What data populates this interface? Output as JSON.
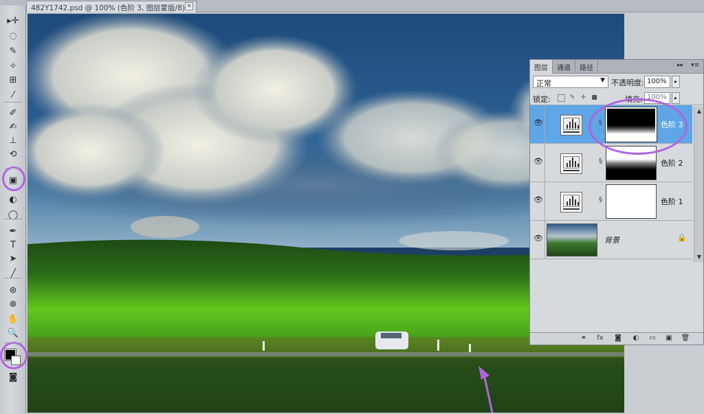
{
  "document": {
    "tab_title": "482Y1742.psd @ 100% (色阶 3, 图层蒙版/8) *",
    "close_glyph": "×"
  },
  "toolbox": {
    "tools": [
      {
        "name": "move-tool-icon",
        "glyph": "▸✛"
      },
      {
        "name": "lasso-tool-icon",
        "glyph": "◌"
      },
      {
        "name": "quick-select-icon",
        "glyph": "✎"
      },
      {
        "name": "magic-wand-icon",
        "glyph": "✧"
      },
      {
        "name": "crop-tool-icon",
        "glyph": "⊞"
      },
      {
        "name": "eyedropper-icon",
        "glyph": "⁄"
      },
      {
        "name": "healing-brush-icon",
        "glyph": "✐"
      },
      {
        "name": "brush-tool-icon",
        "glyph": "✍"
      },
      {
        "name": "clone-stamp-icon",
        "glyph": "⊥"
      },
      {
        "name": "history-brush-icon",
        "glyph": "⟲"
      },
      {
        "name": "gradient-tool-icon",
        "glyph": "▣"
      },
      {
        "name": "blur-tool-icon",
        "glyph": "◐"
      },
      {
        "name": "dodge-tool-icon",
        "glyph": "◯"
      },
      {
        "name": "pen-tool-icon",
        "glyph": "✒"
      },
      {
        "name": "type-tool-icon",
        "glyph": "T"
      },
      {
        "name": "path-select-icon",
        "glyph": "➤"
      },
      {
        "name": "line-tool-icon",
        "glyph": "╱"
      },
      {
        "name": "3d-rotate-icon",
        "glyph": "⊛"
      },
      {
        "name": "3d-orbit-icon",
        "glyph": "⊗"
      },
      {
        "name": "hand-tool-icon",
        "glyph": "✋"
      },
      {
        "name": "zoom-tool-icon",
        "glyph": "🔍"
      },
      {
        "name": "quick-mask-icon",
        "glyph": "◙"
      }
    ]
  },
  "layers_panel": {
    "tabs": [
      "图层",
      "通道",
      "路径"
    ],
    "menu_glyphs": [
      "▸▸",
      "▾≡"
    ],
    "blend_mode": "正常",
    "blend_arrow": "▼",
    "opacity_label": "不透明度:",
    "opacity_value": "100%",
    "lock_label": "锁定:",
    "fill_label": "填充:",
    "fill_value": "100%",
    "stepper_glyph": "▸",
    "layers": [
      {
        "name": "色阶 3",
        "selected": true
      },
      {
        "name": "色阶 2",
        "selected": false
      },
      {
        "name": "色阶 1",
        "selected": false
      },
      {
        "name": "背景",
        "selected": false,
        "locked": true
      }
    ],
    "eye_glyph": "👁",
    "chain_glyph": "§",
    "lock_glyph": "🔒",
    "bottom_icons": [
      "⚭",
      "fx",
      "◙",
      "◐",
      "▭",
      "▣",
      "🗑"
    ]
  },
  "colors": {
    "selected_layer": "#5ea6e6",
    "annotation": "#b064e0"
  }
}
